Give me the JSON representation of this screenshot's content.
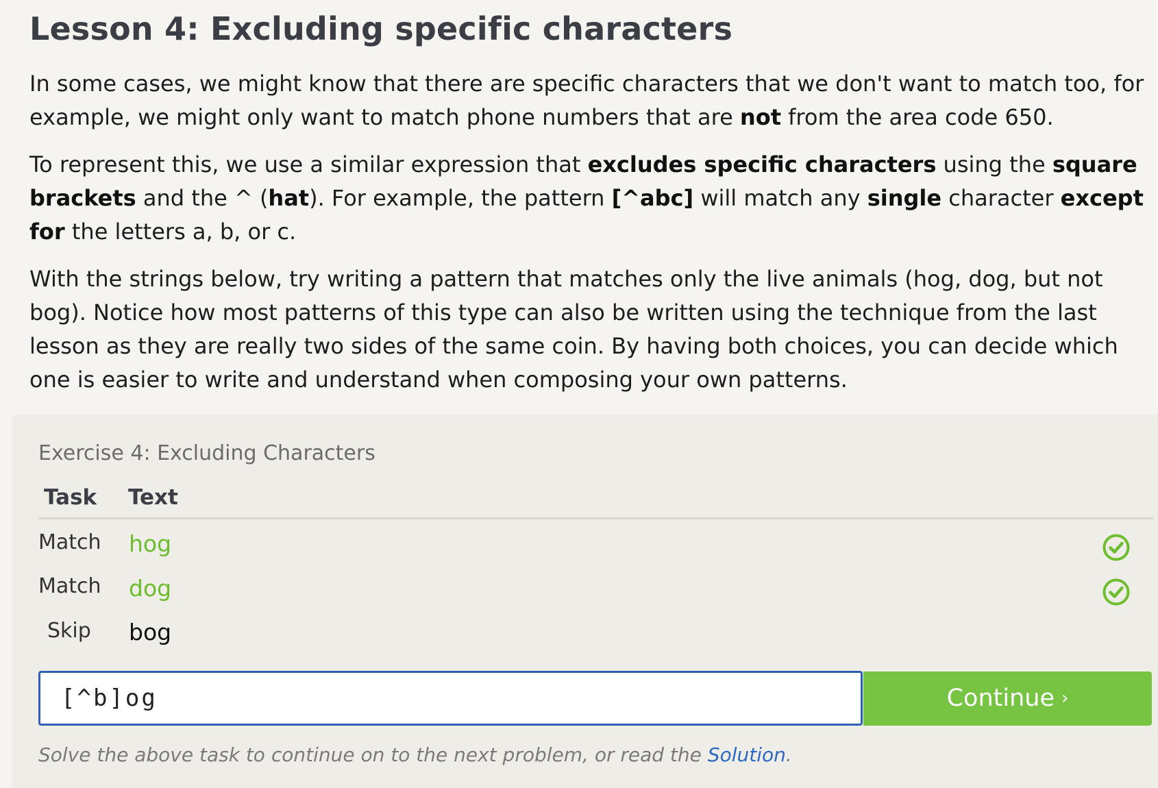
{
  "lesson": {
    "title": "Lesson 4: Excluding specific characters",
    "p1": {
      "t1": "In some cases, we might know that there are specific characters that we don't want to match too, for example, we might only want to match phone numbers that are ",
      "b1": "not",
      "t2": " from the area code 650."
    },
    "p2": {
      "t1": "To represent this, we use a similar expression that ",
      "b1": "excludes specific characters",
      "t2": " using the ",
      "b2": "square brackets",
      "t3": " and the ^ (",
      "b3": "hat",
      "t4": "). For example, the pattern ",
      "b4": "[^abc]",
      "t5": " will match any ",
      "b5": "single",
      "t6": " character ",
      "b6": "except for",
      "t7": " the letters a, b, or c."
    },
    "p3": "With the strings below, try writing a pattern that matches only the live animals (hog, dog, but not bog). Notice how most patterns of this type can also be written using the technique from the last lesson as they are really two sides of the same coin. By having both choices, you can decide which one is easier to write and understand when composing your own patterns."
  },
  "exercise": {
    "title": "Exercise 4: Excluding Characters",
    "headers": {
      "task": "Task",
      "text": "Text"
    },
    "rows": [
      {
        "task": "Match",
        "text": "hog",
        "status": "success"
      },
      {
        "task": "Match",
        "text": "dog",
        "status": "success"
      },
      {
        "task": "Skip",
        "text": "bog",
        "status": "none"
      }
    ],
    "input_value": "[^b]og",
    "continue_label": "Continue",
    "continue_chevron": "›",
    "hint_before": "Solve the above task to continue on to the next problem, or read the ",
    "hint_link": "Solution",
    "hint_after": "."
  },
  "colors": {
    "accent_green": "#76c442",
    "match_green": "#6ebd2f",
    "input_border": "#2f5fb4",
    "link_blue": "#2a68c4"
  },
  "icons": {
    "success": "check-circle-icon"
  }
}
